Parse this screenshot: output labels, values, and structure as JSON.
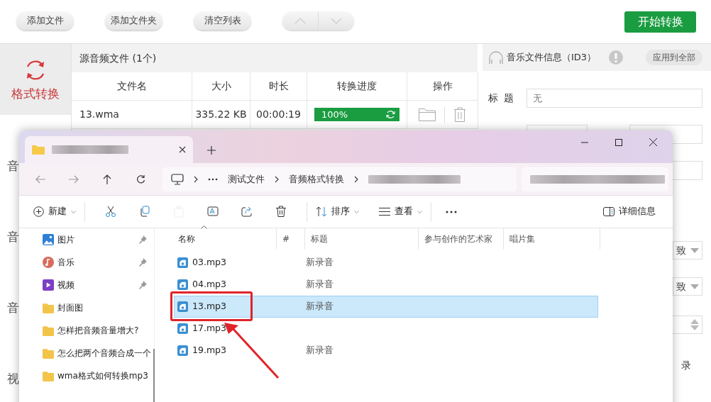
{
  "toolbar": {
    "buttons": [
      {
        "label": "添加文件"
      },
      {
        "label": "添加文件夹"
      },
      {
        "label": "清空列表"
      }
    ],
    "reorder": {
      "disabled": true
    },
    "start_button": "开始转换"
  },
  "sidebar": {
    "items": [
      {
        "label": "格式转换",
        "selected": true
      },
      {
        "label": "音",
        "selected": false
      },
      {
        "label": "音",
        "selected": false
      },
      {
        "label": "音",
        "selected": false
      },
      {
        "label": "视",
        "selected": false
      }
    ]
  },
  "source_files": {
    "title": "源音频文件 (1个)",
    "columns": [
      "文件名",
      "大小",
      "时长",
      "转换进度",
      "操作"
    ],
    "rows": [
      {
        "name": "13.wma",
        "size": "335.22 KB",
        "duration": "00:00:19",
        "progress": {
          "level": 1,
          "reading": "100%"
        }
      }
    ]
  },
  "id3_panel": {
    "title": "音乐文件信息（ID3）",
    "apply_all": "应用到全部",
    "fields": [
      {
        "label": "标 题",
        "placeholder": "无"
      }
    ],
    "partial_controls": [
      {
        "kind": "inputs"
      },
      {
        "kind": "input"
      },
      {
        "kind": "select",
        "value": "致"
      },
      {
        "kind": "select",
        "value": "致"
      },
      {
        "kind": "spinner"
      },
      {
        "kind": "text",
        "value": "录"
      }
    ]
  },
  "explorer": {
    "breadcrumb": [
      "测试文件",
      "音频格式转换"
    ],
    "commands": {
      "new": "新建",
      "tools": [
        {
          "disabled": false
        },
        {
          "disabled": false
        },
        {
          "disabled": true
        },
        {
          "disabled": false
        },
        {
          "disabled": false
        },
        {
          "disabled": false
        }
      ],
      "sort": "排序",
      "view": "查看",
      "details": "详细信息"
    },
    "nav_pane": {
      "items": [
        {
          "label": "图片",
          "pinned": true,
          "kind": "pictures"
        },
        {
          "label": "音乐",
          "pinned": true,
          "kind": "music"
        },
        {
          "label": "视频",
          "pinned": true,
          "kind": "videos"
        },
        {
          "label": "封面图",
          "pinned": false,
          "kind": "folder"
        },
        {
          "label": "怎样把音频音量增大?",
          "pinned": false,
          "kind": "folder"
        },
        {
          "label": "怎么把两个音频合成一个",
          "pinned": false,
          "kind": "folder"
        },
        {
          "label": "wma格式如何转换mp3",
          "pinned": false,
          "kind": "folder"
        }
      ]
    },
    "file_list": {
      "columns": [
        {
          "label": "名称",
          "sorted": true
        },
        {
          "label": "#",
          "sorted": false
        },
        {
          "label": "标题",
          "sorted": false
        },
        {
          "label": "参与创作的艺术家",
          "sorted": false
        },
        {
          "label": "唱片集",
          "sorted": false
        }
      ],
      "rows": [
        {
          "name": "03.mp3",
          "title": "新录音",
          "selected": false,
          "highlighted": false
        },
        {
          "name": "04.mp3",
          "title": "新录音",
          "selected": false,
          "highlighted": false
        },
        {
          "name": "13.mp3",
          "title": "新录音",
          "selected": true,
          "highlighted": true
        },
        {
          "name": "17.mp3",
          "selected": false,
          "highlighted": false
        },
        {
          "name": "19.mp3",
          "title": "新录音",
          "selected": false,
          "highlighted": false
        }
      ]
    }
  }
}
